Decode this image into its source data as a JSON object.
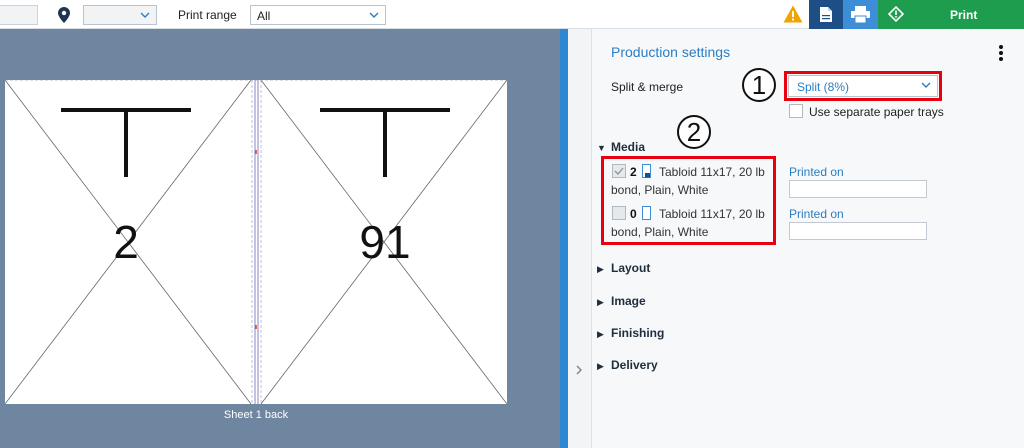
{
  "toolbar": {
    "location_value": "",
    "location_icon": "location-pin-icon",
    "location_select_value": "",
    "print_range_label": "Print range",
    "print_range_value": "All",
    "warning_icon": "warning-icon",
    "document_icon": "document-icon",
    "printer_icon": "printer-icon",
    "print_icon": "print-diamond-icon",
    "print_label": "Print",
    "colors": {
      "print_green": "#1e9d4f",
      "doc_blue": "#1d4f86",
      "printer_blue": "#3d8ed6",
      "warning": "#f1a300"
    }
  },
  "preview": {
    "left_page": {
      "letter": "T",
      "number": "2"
    },
    "right_page": {
      "letter": "T",
      "number": "91"
    },
    "caption": "Sheet 1 back",
    "background": "#6f86a0"
  },
  "panel": {
    "title": "Production settings",
    "split_merge": {
      "label": "Split & merge",
      "value": "Split (8%)",
      "annotation": "1"
    },
    "separate_trays": {
      "label": "Use separate paper trays",
      "checked": false
    },
    "media": {
      "label": "Media",
      "expanded": true,
      "annotation": "2",
      "items": [
        {
          "count": "2",
          "line1": "Tabloid 11x17, 20 lb",
          "line2": "bond, Plain, White",
          "checked": true,
          "link": "Printed on",
          "input_value": ""
        },
        {
          "count": "0",
          "line1": "Tabloid 11x17, 20 lb",
          "line2": "bond, Plain, White",
          "checked": false,
          "link": "Printed on",
          "input_value": ""
        }
      ]
    },
    "sections": [
      {
        "label": "Layout"
      },
      {
        "label": "Image"
      },
      {
        "label": "Finishing"
      },
      {
        "label": "Delivery"
      }
    ],
    "accent": "#2a7ec2",
    "highlight": "#e8000f"
  }
}
